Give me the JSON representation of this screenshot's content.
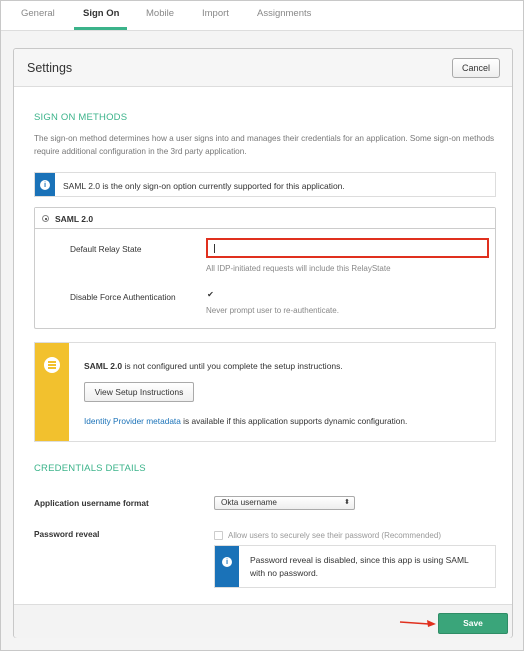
{
  "tabs": [
    {
      "label": "General"
    },
    {
      "label": "Sign On"
    },
    {
      "label": "Mobile"
    },
    {
      "label": "Import"
    },
    {
      "label": "Assignments"
    }
  ],
  "active_tab": "Sign On",
  "panel": {
    "title": "Settings",
    "cancel_label": "Cancel"
  },
  "sign_on_methods": {
    "heading": "SIGN ON METHODS",
    "description": "The sign-on method determines how a user signs into and manages their credentials for an application. Some sign-on methods require additional configuration in the 3rd party application.",
    "info_text": "SAML 2.0 is the only sign-on option currently supported for this application.",
    "info_icon": "info-icon"
  },
  "saml": {
    "option_label": "SAML 2.0",
    "relay_state_label": "Default Relay State",
    "relay_state_value": "",
    "relay_state_hint": "All IDP-initiated requests will include this RelayState",
    "force_auth_label": "Disable Force Authentication",
    "force_auth_checked": true,
    "force_auth_hint": "Never prompt user to re-authenticate."
  },
  "setup_notice": {
    "icon": "list-icon",
    "strip_color": "#f2c12e",
    "bold": "SAML 2.0",
    "text": " is not configured until you complete the setup instructions.",
    "button_label": "View Setup Instructions",
    "metadata_link": "Identity Provider metadata",
    "metadata_text": " is available if this application supports dynamic configuration."
  },
  "credentials": {
    "heading": "CREDENTIALS DETAILS",
    "username_format_label": "Application username format",
    "username_format_value": "Okta username",
    "password_reveal_label": "Password reveal",
    "password_reveal_checkbox_label": "Allow users to securely see their password (Recommended)",
    "password_reveal_checked": false,
    "info_text": "Password reveal is disabled, since this app is using SAML with no password."
  },
  "footer": {
    "save_label": "Save"
  },
  "colors": {
    "accent": "#3bb38a",
    "info": "#1a72b8",
    "warning": "#f2c12e",
    "highlight": "#e0301e",
    "save": "#3aa57a"
  }
}
